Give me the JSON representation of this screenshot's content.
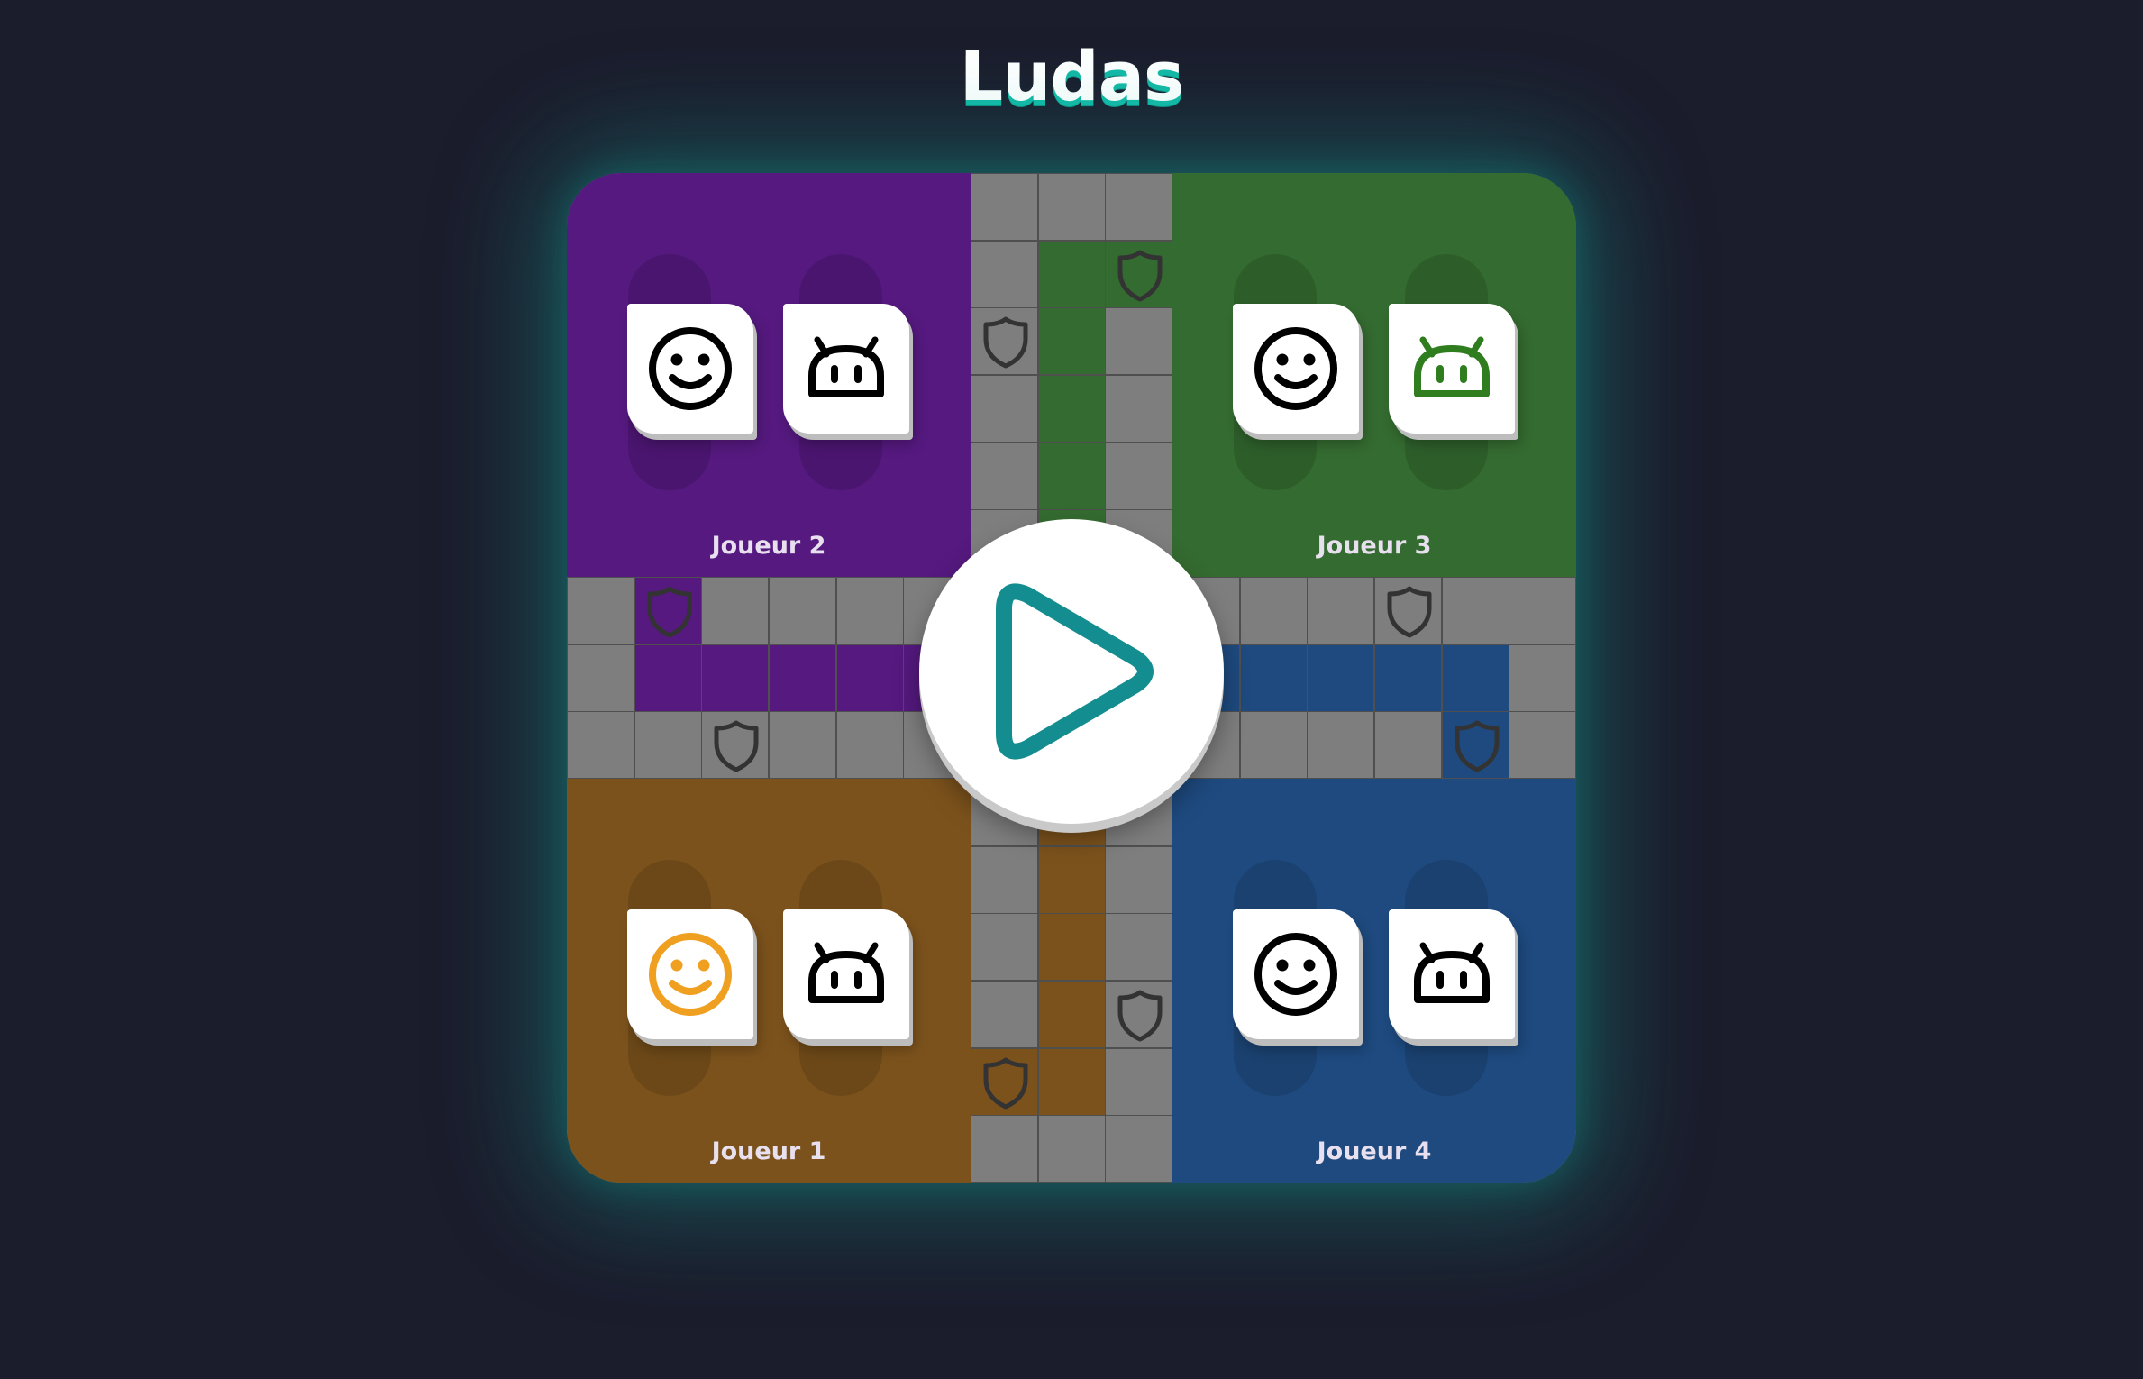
{
  "app": {
    "title": "Ludas"
  },
  "colors": {
    "purple": "#55197f",
    "green": "#346b30",
    "brown": "#7c521c",
    "blue": "#1e4a7f",
    "track": "#7e7e7e",
    "accent": "#14b8a6",
    "play_icon": "#138d8f"
  },
  "players": [
    {
      "id": "player-2",
      "label": "Joueur 2",
      "color": "purple",
      "pieces": [
        {
          "icon": "smiley-face-icon",
          "tint": "#000000"
        },
        {
          "icon": "robot-face-icon",
          "tint": "#000000"
        }
      ]
    },
    {
      "id": "player-3",
      "label": "Joueur 3",
      "color": "green",
      "pieces": [
        {
          "icon": "smiley-face-icon",
          "tint": "#000000"
        },
        {
          "icon": "robot-face-icon",
          "tint": "#2f7d1f"
        }
      ]
    },
    {
      "id": "player-1",
      "label": "Joueur 1",
      "color": "brown",
      "pieces": [
        {
          "icon": "smiley-face-icon",
          "tint": "#f0a020"
        },
        {
          "icon": "robot-face-icon",
          "tint": "#000000"
        }
      ]
    },
    {
      "id": "player-4",
      "label": "Joueur 4",
      "color": "blue",
      "pieces": [
        {
          "icon": "smiley-face-icon",
          "tint": "#000000"
        },
        {
          "icon": "robot-face-icon",
          "tint": "#000000"
        }
      ]
    }
  ],
  "play_button": {
    "icon": "play-icon"
  },
  "safe_square_icon": "shield-icon"
}
